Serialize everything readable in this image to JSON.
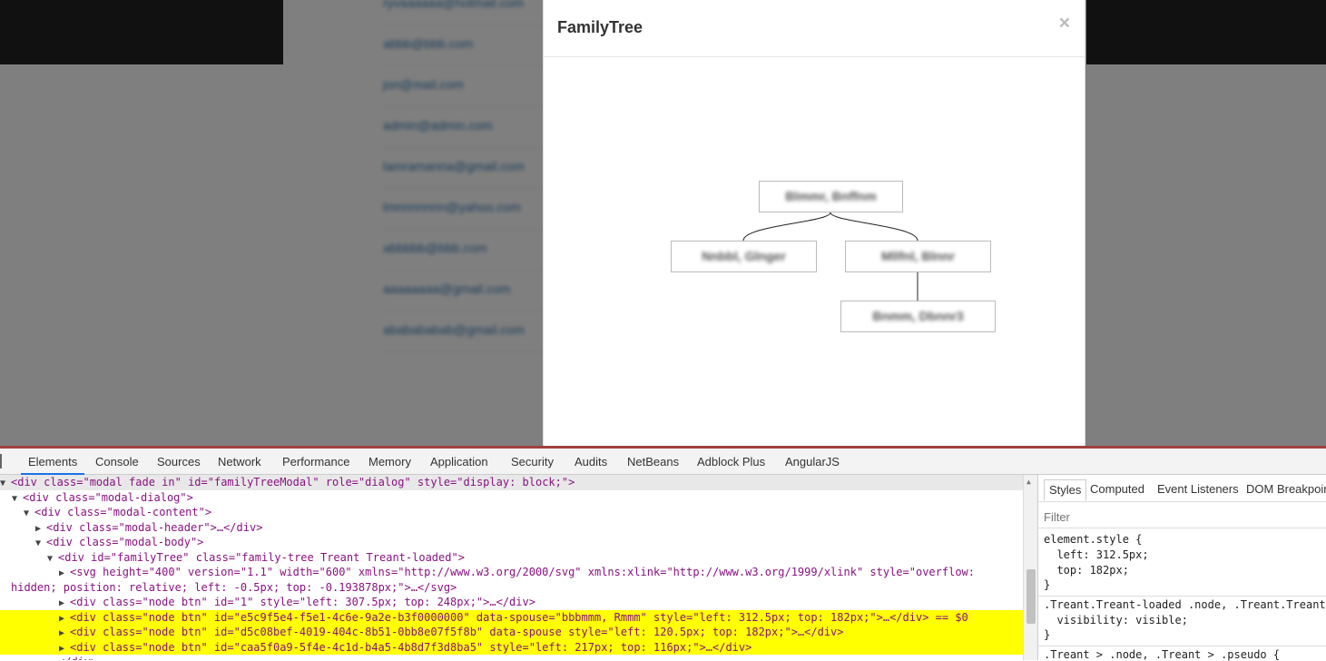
{
  "page": {
    "emails": [
      "ryvaaaaaa@hotmail.com",
      "abbb@bbb.com",
      "jon@mail.com",
      "admin@admin.com",
      "lamramanna@gmail.com",
      "lmnnnnnnn@yahoo.com",
      "abbbbb@bbb.com",
      "aaaaaaaa@gmail.com",
      "ababababab@gmail.com"
    ]
  },
  "modal": {
    "title": "FamilyTree",
    "close_label": "×",
    "nodes": [
      {
        "label": "Blmmr, Bnffnm"
      },
      {
        "label": "Nnbbl, Glnger"
      },
      {
        "label": "Mllfnl, Blnnr"
      },
      {
        "label": "Bnmm, Dbnnr3"
      }
    ]
  },
  "devtools": {
    "tabs": [
      "Elements",
      "Console",
      "Sources",
      "Network",
      "Performance",
      "Memory",
      "Application",
      "Security",
      "Audits",
      "NetBeans",
      "Adblock Plus",
      "AngularJS"
    ],
    "active_tab": "Elements",
    "dom_lines": [
      {
        "html": "&lt;div class=\"modal fade in\" id=\"familyTreeModal\" role=\"dialog\" style=\"display: block;\"&gt;",
        "tri": "▼",
        "indent": 0
      },
      {
        "html": "&lt;div class=\"modal-dialog\"&gt;",
        "tri": "▼",
        "indent": 1
      },
      {
        "html": "&lt;div class=\"modal-content\"&gt;",
        "tri": "▼",
        "indent": 2
      },
      {
        "html": "&lt;div class=\"modal-header\"&gt;…&lt;/div&gt;",
        "tri": "▶",
        "indent": 3
      },
      {
        "html": "&lt;div class=\"modal-body\"&gt;",
        "tri": "▼",
        "indent": 3
      },
      {
        "html": "&lt;div id=\"familyTree\" class=\"family-tree Treant Treant-loaded\"&gt;",
        "tri": "▼",
        "indent": 4
      },
      {
        "html": "&lt;svg height=\"400\" version=\"1.1\" width=\"600\" xmlns=\"http://www.w3.org/2000/svg\" xmlns:xlink=\"http://www.w3.org/1999/xlink\" style=\"overflow:",
        "tri": "▶",
        "indent": 5
      },
      {
        "html": "hidden; position: relative; left: -0.5px; top: -0.193878px;\"&gt;…&lt;/svg&gt;",
        "tri": "",
        "indent": 0
      },
      {
        "html": "&lt;div class=\"node  btn\" id=\"1\" style=\"left: 307.5px; top: 248px;\"&gt;…&lt;/div&gt;",
        "tri": "▶",
        "indent": 5
      },
      {
        "html": "&lt;div class=\"node  btn\" id=\"e5c9f5e4-f5e1-4c6e-9a2e-b3f0000000\" data-spouse=\"bbbmmm, Rmmm\" style=\"left: 312.5px; top: 182px;\"&gt;…&lt;/div&gt; == $0",
        "tri": "▶",
        "indent": 5
      },
      {
        "html": "&lt;div class=\"node  btn\" id=\"d5c08bef-4019-404c-8b51-0bb8e07f5f8b\" data-spouse style=\"left: 120.5px; top: 182px;\"&gt;…&lt;/div&gt;",
        "tri": "▶",
        "indent": 5
      },
      {
        "html": "&lt;div class=\"node  btn\" id=\"caa5f0a9-5f4e-4c1d-b4a5-4b8d7f3d8ba5\" style=\"left: 217px; top: 116px;\"&gt;…&lt;/div&gt;",
        "tri": "▶",
        "indent": 5
      },
      {
        "html": "&lt;/div&gt;",
        "tri": "",
        "indent": 4
      }
    ],
    "styles": {
      "tabs": [
        "Styles",
        "Computed",
        "Event Listeners",
        "DOM Breakpoints"
      ],
      "filter_placeholder": "Filter",
      "rules": [
        "element.style {",
        "  left: 312.5px;",
        "  top: 182px;",
        "}",
        ".Treant.Treant-loaded .node, .Treant.Treant",
        "  visibility: visible;",
        "}",
        ".Treant > .node, .Treant > .pseudo {"
      ]
    }
  }
}
